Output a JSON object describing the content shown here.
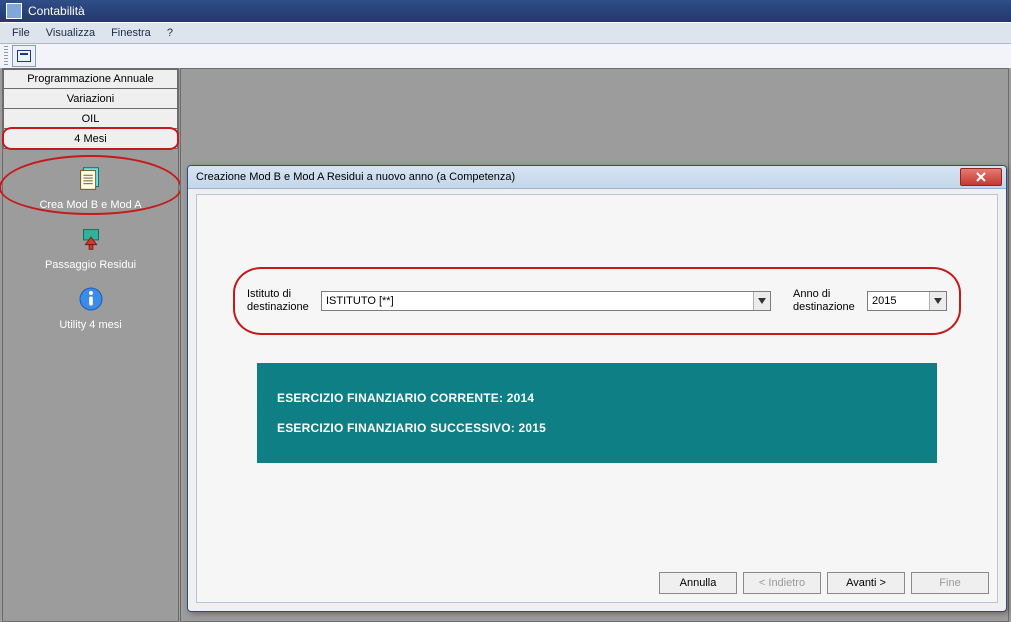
{
  "app": {
    "title": "Contabilità"
  },
  "menu": {
    "file": "File",
    "visualizza": "Visualizza",
    "finestra": "Finestra",
    "help": "?"
  },
  "sidebar": {
    "buttons": {
      "programmazione": "Programmazione Annuale",
      "variazioni": "Variazioni",
      "oil": "OIL",
      "mesi4": "4 Mesi"
    },
    "items": {
      "crea": "Crea Mod B e Mod A",
      "passaggio": "Passaggio Residui",
      "utility": "Utility 4 mesi"
    }
  },
  "dialog": {
    "title": "Creazione Mod B e Mod A Residui a nuovo anno (a Competenza)",
    "istituto_label_line1": "Istituto di",
    "istituto_label_line2": "destinazione",
    "istituto_value": "ISTITUTO [**]",
    "anno_label_line1": "Anno di",
    "anno_label_line2": "destinazione",
    "anno_value": "2015",
    "banner1": "ESERCIZIO FINANZIARIO CORRENTE: 2014",
    "banner2": "ESERCIZIO FINANZIARIO SUCCESSIVO: 2015",
    "buttons": {
      "annulla": "Annulla",
      "indietro": "< Indietro",
      "avanti": "Avanti >",
      "fine": "Fine"
    }
  }
}
